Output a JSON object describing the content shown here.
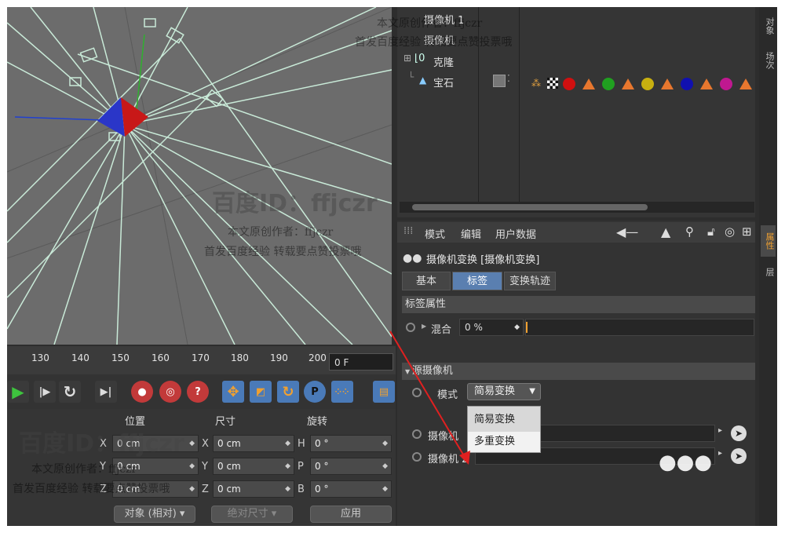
{
  "viewport": {
    "label": "3D viewport"
  },
  "timeline": {
    "ticks": [
      "130",
      "140",
      "150",
      "160",
      "170",
      "180",
      "190",
      "200"
    ],
    "frame_value": "0 F"
  },
  "transport": {
    "icons": [
      "play-icon",
      "step-forward-icon",
      "loop-icon",
      "go-to-end-icon",
      "record-key-icon",
      "autokey-icon",
      "help-key-icon",
      "move-icon",
      "scale-icon",
      "rotate-icon",
      "parameter-icon",
      "points-icon",
      "film-icon"
    ],
    "p_label": "P"
  },
  "coords": {
    "headers": {
      "position": "位置",
      "size": "尺寸",
      "rotation": "旋转"
    },
    "rows": [
      {
        "axis": "X",
        "pos": "0 cm",
        "size": "0 cm",
        "raxis": "H",
        "rot": "0 °"
      },
      {
        "axis": "Y",
        "pos": "0 cm",
        "size": "0 cm",
        "raxis": "P",
        "rot": "0 °"
      },
      {
        "axis": "Z",
        "pos": "0 cm",
        "size": "0 cm",
        "raxis": "B",
        "rot": "0 °"
      }
    ],
    "mode_select": "对象 (相对)",
    "size_select": "绝对尺寸",
    "apply_label": "应用"
  },
  "object_manager": {
    "objects": [
      {
        "name": "摄像机 1"
      },
      {
        "name": "摄像机"
      },
      {
        "name": "克隆"
      },
      {
        "name": "宝石"
      }
    ],
    "tag_colors": [
      "#d01010",
      "#20a020",
      "#c8b010",
      "#1010b0",
      "#c01890"
    ],
    "tri_color": "#e8772e"
  },
  "side_tabs": [
    "对象",
    "场次",
    "属性",
    "层"
  ],
  "attributes": {
    "menu": {
      "mode": "模式",
      "edit": "编辑",
      "userdata": "用户数据"
    },
    "title": "摄像机变换 [摄像机变换]",
    "tabs": [
      "基本",
      "标签",
      "变换轨迹"
    ],
    "active_tab": "标签",
    "section_tag": "标签属性",
    "blend_label": "混合",
    "blend_value": "0 %",
    "section_source": "源摄像机",
    "mode_label": "模式",
    "mode_value": "简易变换",
    "dropdown_options": [
      "简易变换",
      "多重变换"
    ],
    "camera1_label": "摄像机",
    "camera2_label": "摄像机 2"
  },
  "watermark": {
    "id": "百度ID：ffjczr",
    "line1": "本文原创作者：ffjczr",
    "line2": "首发百度经验  转载要点赞投票哦"
  }
}
